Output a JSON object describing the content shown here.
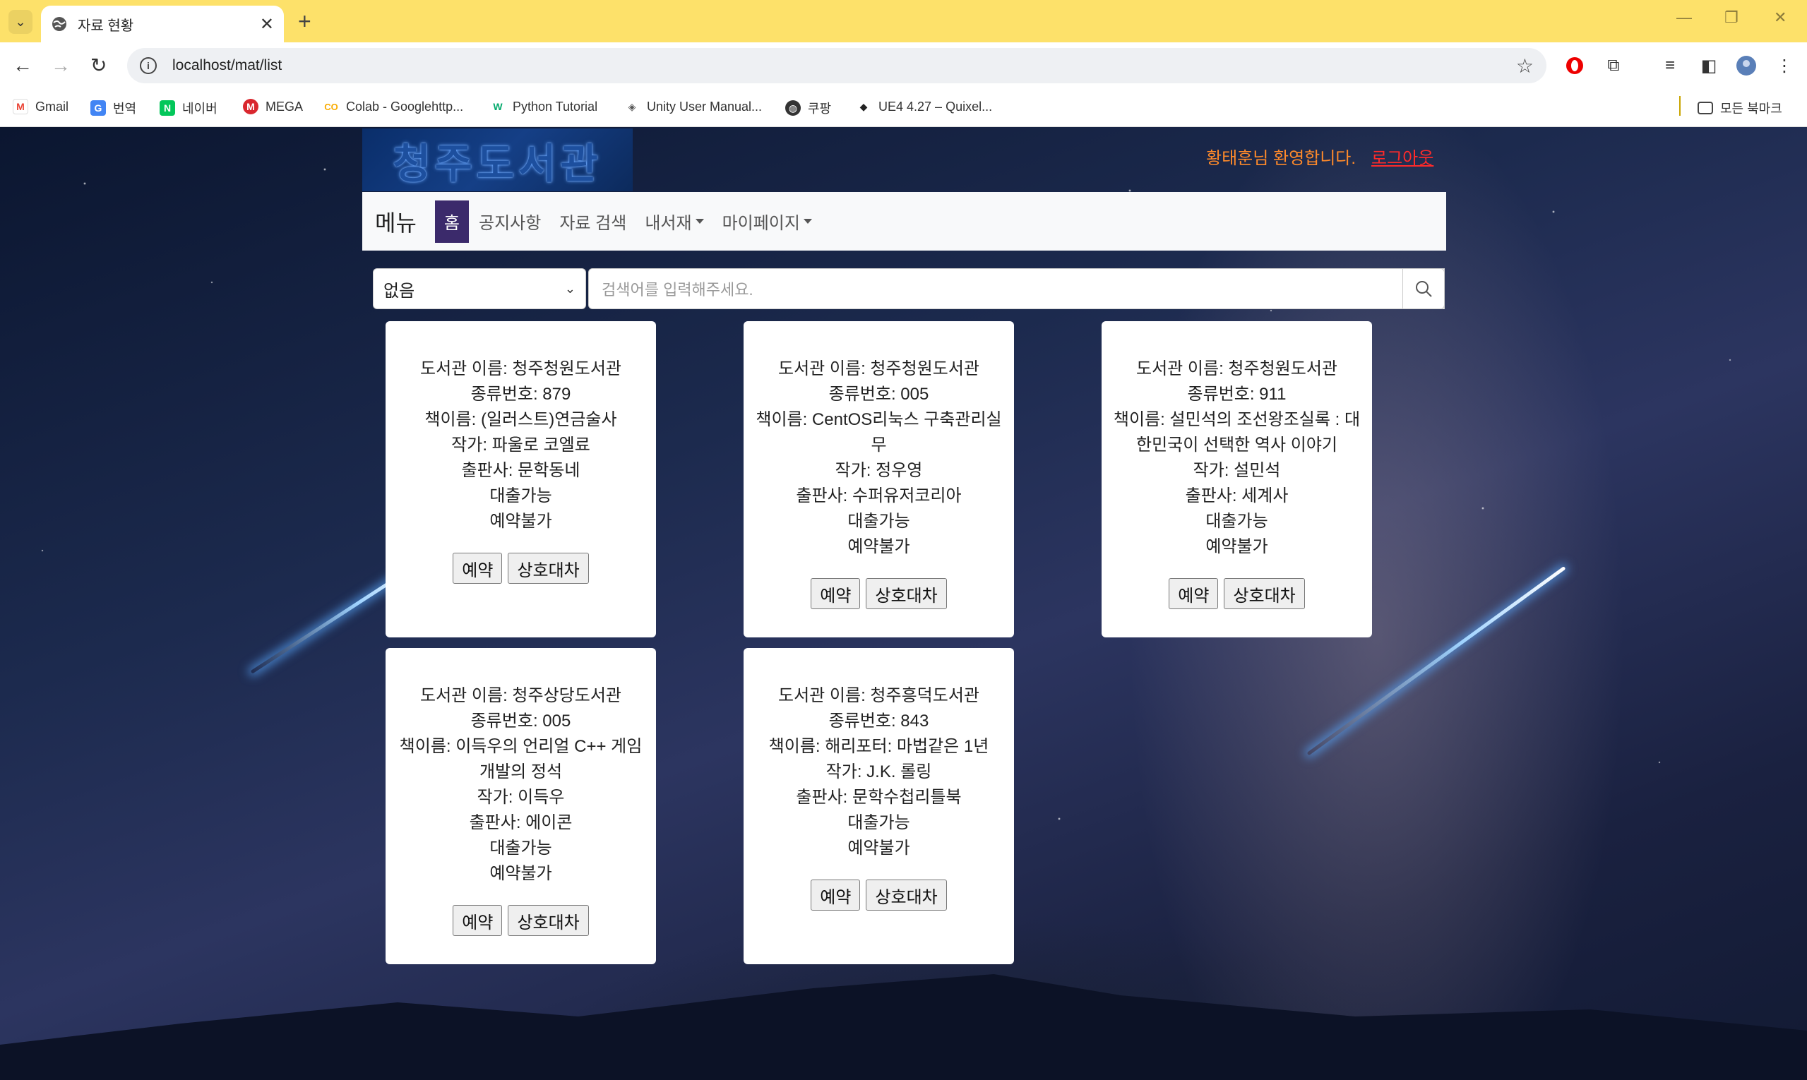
{
  "browser": {
    "tab_title": "자료 현황",
    "url": "localhost/mat/list",
    "bookmarks": [
      {
        "label": "Gmail",
        "icon": "gmail-icon",
        "color": "#ea4335"
      },
      {
        "label": "번역",
        "icon": "translate-icon",
        "color": "#4285f4"
      },
      {
        "label": "네이버",
        "icon": "naver-icon",
        "color": "#03c75a"
      },
      {
        "label": "MEGA",
        "icon": "mega-icon",
        "color": "#d9272e"
      },
      {
        "label": "Colab - Googlehttp...",
        "icon": "colab-icon",
        "color": "#f9ab00"
      },
      {
        "label": "Python Tutorial",
        "icon": "w3schools-icon",
        "color": "#04aa6d"
      },
      {
        "label": "Unity User Manual...",
        "icon": "unity-icon",
        "color": "#555555"
      },
      {
        "label": "쿠팡",
        "icon": "globe-icon",
        "color": "#333333"
      },
      {
        "label": "UE4 4.27 – Quixel...",
        "icon": "quixel-icon",
        "color": "#222222"
      }
    ],
    "all_bookmarks": "모든 북마크"
  },
  "site": {
    "logo_text": "청주도서관",
    "welcome": "황태훈님 환영합니다.",
    "logout": "로그아웃"
  },
  "nav": {
    "brand": "메뉴",
    "items": [
      {
        "label": "홈",
        "active": true,
        "dropdown": false
      },
      {
        "label": "공지사항",
        "active": false,
        "dropdown": false
      },
      {
        "label": "자료 검색",
        "active": false,
        "dropdown": false
      },
      {
        "label": "내서재",
        "active": false,
        "dropdown": true
      },
      {
        "label": "마이페이지",
        "active": false,
        "dropdown": true
      }
    ]
  },
  "search": {
    "select_value": "없음",
    "placeholder": "검색어를 입력해주세요."
  },
  "cards": [
    {
      "library": "도서관 이름: 청주청원도서관",
      "code": "종류번호: 879",
      "title": "책이름: (일러스트)연금술사",
      "author": "작가: 파울로 코엘료",
      "publisher": "출판사: 문학동네",
      "loan": "대출가능",
      "reserve": "예약불가",
      "reserve_btn": "예약",
      "ill_btn": "상호대차"
    },
    {
      "library": "도서관 이름: 청주청원도서관",
      "code": "종류번호: 005",
      "title": "책이름: CentOS리눅스 구축관리실무",
      "author": "작가: 정우영",
      "publisher": "출판사: 수퍼유저코리아",
      "loan": "대출가능",
      "reserve": "예약불가",
      "reserve_btn": "예약",
      "ill_btn": "상호대차"
    },
    {
      "library": "도서관 이름: 청주청원도서관",
      "code": "종류번호: 911",
      "title": "책이름: 설민석의 조선왕조실록 : 대한민국이 선택한 역사 이야기",
      "author": "작가: 설민석",
      "publisher": "출판사: 세계사",
      "loan": "대출가능",
      "reserve": "예약불가",
      "reserve_btn": "예약",
      "ill_btn": "상호대차"
    },
    {
      "library": "도서관 이름: 청주상당도서관",
      "code": "종류번호: 005",
      "title": "책이름: 이득우의 언리얼 C++ 게임 개발의 정석",
      "author": "작가: 이득우",
      "publisher": "출판사: 에이콘",
      "loan": "대출가능",
      "reserve": "예약불가",
      "reserve_btn": "예약",
      "ill_btn": "상호대차"
    },
    {
      "library": "도서관 이름: 청주흥덕도서관",
      "code": "종류번호: 843",
      "title": "책이름: 해리포터: 마법같은 1년",
      "author": "작가: J.K. 롤링",
      "publisher": "출판사: 문학수첩리틀북",
      "loan": "대출가능",
      "reserve": "예약불가",
      "reserve_btn": "예약",
      "ill_btn": "상호대차"
    }
  ]
}
